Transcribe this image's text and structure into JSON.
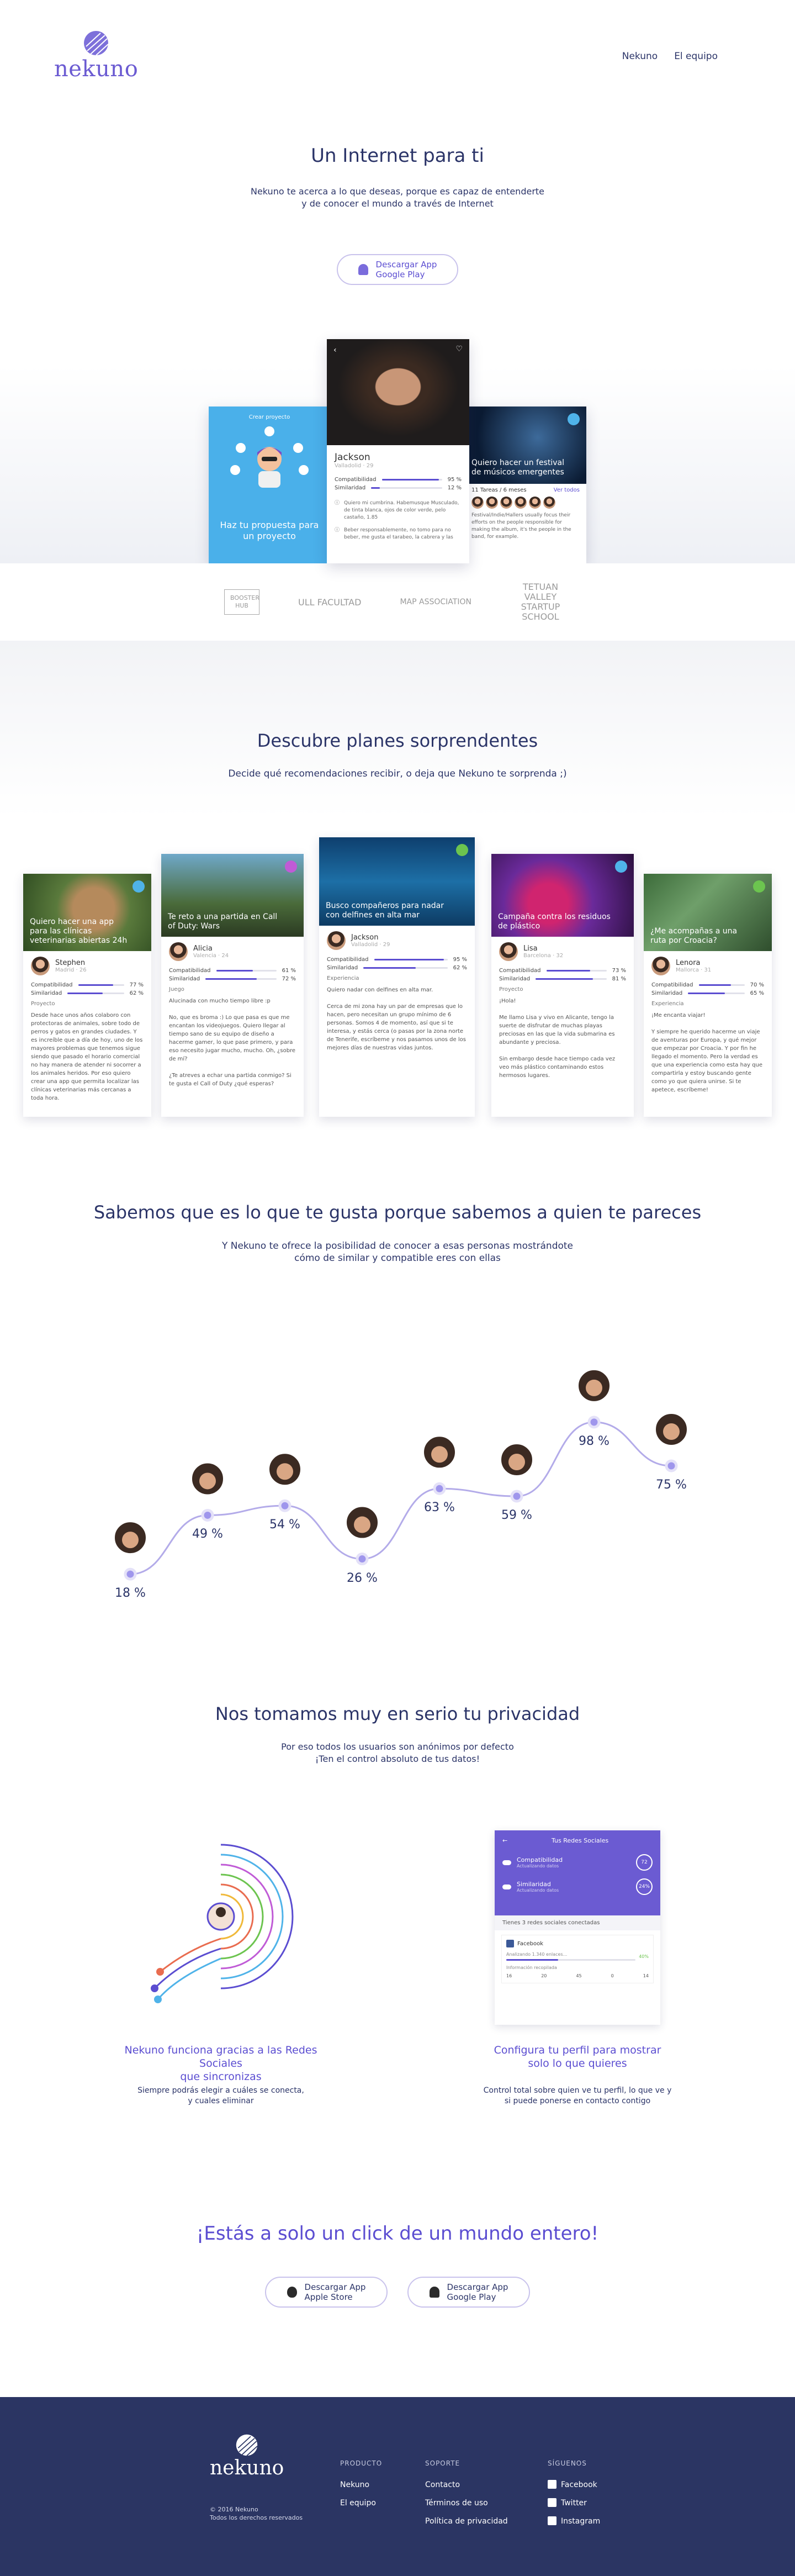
{
  "brand": {
    "name": "nekuno",
    "accent": "#5b4dd1",
    "dark": "#2b3468"
  },
  "nav": {
    "items": [
      "Nekuno",
      "El equipo"
    ]
  },
  "hero": {
    "title": "Un Internet para ti",
    "subtitle_l1": "Nekuno te acerca a lo que deseas, porque es capaz de entenderte",
    "subtitle_l2": "y de conocer el mundo a través de Internet",
    "download_l1": "Descargar App",
    "download_l2": "Google Play"
  },
  "hero_phones": {
    "left": {
      "top": "Crear proyecto",
      "caption": "Haz tu propuesta para un proyecto"
    },
    "center": {
      "name": "Jackson",
      "meta": "Valladolid · 29",
      "stat1": "Compatibilidad",
      "stat1_val": "95 %",
      "stat2": "Similaridad",
      "stat2_val": "12 %",
      "q1": "Quiero mi cumbrina. Habemusque Musculado, de tinta blanca, ojos de color verde, pelo castaño, 1.85",
      "q2": "Beber responsablemente, no tomo para no beber, me gusta el tarabeo, la cabrera y las"
    },
    "right": {
      "caption": "Quiero hacer un festival de músicos emergentes",
      "tab1": "11 Tareas / 6 meses",
      "tab2": "Ver todos",
      "text": "Festival/Indie/Hallers usually focus their efforts on the people responsible for making the album, it's the people in the band, for example."
    }
  },
  "partners": [
    "BOOSTER HUB",
    "ULL FACULTAD",
    "MAP ASSOCIATION",
    "TETUAN VALLEY STARTUP SCHOOL"
  ],
  "plans": {
    "title": "Descubre planes sorprendentes",
    "subtitle": "Decide qué recomendaciones recibir, o deja que Nekuno te sorprenda ;)",
    "cards": [
      {
        "caption": "Quiero hacer una app para las clínicas veterinarias abiertas 24h",
        "name": "Stephen",
        "meta": "Madrid · 26",
        "c": "77 %",
        "s": "62 %",
        "section": "Proyecto",
        "text": "Desde hace unos años colaboro con protectoras de animales, sobre todo de perros y gatos en grandes ciudades. Y es increíble que a día de hoy, uno de los mayores problemas que tenemos sigue siendo que pasado el horario comercial no hay manera de atender ni socorrer a los animales heridos. Por eso quiero crear una app que permita localizar las clínicas veterinarias más cercanas a toda hora.",
        "badge": "#4fb3e9"
      },
      {
        "caption": "Te reto a una partida en Call of Duty: Wars",
        "name": "Alicia",
        "meta": "Valencia · 24",
        "c": "61 %",
        "s": "72 %",
        "section": "Juego",
        "text": "Alucinada con mucho tiempo libre :p\n\nNo, que es broma :) Lo que pasa es que me encantan los videojuegos. Quiero llegar al tiempo sano de su equipo de diseño a hacerme gamer, lo que pase primero, y para eso necesito jugar mucho, mucho. Oh, ¿sobre de mí?\n\n¿Te atreves a echar una partida conmigo? Si te gusta el Call of Duty ¿qué esperas?",
        "badge": "#c05bd6"
      },
      {
        "caption": "Busco compañeros para nadar con delfines en alta mar",
        "name": "Jackson",
        "meta": "Valladolid · 29",
        "c": "95 %",
        "s": "62 %",
        "section": "Experiencia",
        "text": "Quiero nadar con delfines en alta mar.\n\nCerca de mi zona hay un par de empresas que lo hacen, pero necesitan un grupo mínimo de 6 personas. Somos 4 de momento, así que si te interesa, y estás cerca (o pasas por la zona norte de Tenerife, escríbeme y nos pasamos unos de los mejores días de nuestras vidas juntos.",
        "badge": "#6cc44f"
      },
      {
        "caption": "Campaña contra los residuos de plástico",
        "name": "Lisa",
        "meta": "Barcelona · 32",
        "c": "73 %",
        "s": "81 %",
        "section": "Proyecto",
        "text": "¡Hola!\n\nMe llamo Lisa y vivo en Alicante, tengo la suerte de disfrutar de muchas playas preciosas en las que la vida submarina es abundante y preciosa.\n\nSin embargo desde hace tiempo cada vez veo más plástico contaminando estos hermosos lugares.",
        "badge": "#4fb3e9"
      },
      {
        "caption": "¿Me acompañas a una ruta por Croacia?",
        "name": "Lenora",
        "meta": "Mallorca · 31",
        "c": "70 %",
        "s": "65 %",
        "section": "Experiencia",
        "text": "¡Me encanta viajar!\n\nY siempre he querido hacerme un viaje de aventuras por Europa, y qué mejor que empezar por Croacia. Y por fin he llegado el momento. Pero la verdad es que una experiencia como esta hay que compartirla y estoy buscando gente como yo que quiera unirse. Si te apetece, escríbeme!",
        "badge": "#6cc44f"
      }
    ]
  },
  "match": {
    "title": "Sabemos que es lo que te gusta porque sabemos a quien te pareces",
    "subtitle_l1": "Y Nekuno te ofrece la posibilidad de conocer a esas personas mostrándote",
    "subtitle_l2": "cómo de similar y compatible eres con ellas",
    "chart_data": {
      "type": "line",
      "categories": [
        "1",
        "2",
        "3",
        "4",
        "5",
        "6",
        "7",
        "8"
      ],
      "series": [
        {
          "values": [
            18,
            49,
            54,
            26,
            63,
            59,
            98,
            75
          ]
        }
      ],
      "labels": [
        "18 %",
        "49 %",
        "54 %",
        "26 %",
        "63 %",
        "59 %",
        "98 %",
        "75 %"
      ],
      "ylim": [
        0,
        100
      ]
    }
  },
  "privacy": {
    "title": "Nos tomamos muy en serio tu privacidad",
    "subtitle_l1": "Por eso todos los usuarios son anónimos por defecto",
    "subtitle_l2": "¡Ten el control absoluto de tus datos!",
    "left_title_l1": "Nekuno funciona gracias a las Redes Sociales",
    "left_title_l2": "que sincronizas",
    "left_text_l1": "Siempre podrás elegir a cuáles se conecta,",
    "left_text_l2": "y cuales eliminar",
    "right_title_l1": "Configura tu perfil para mostrar",
    "right_title_l2": "solo lo que quieres",
    "right_text_l1": "Control total sobre quien ve tu perfil, lo que ve y",
    "right_text_l2": "si puede ponerse en contacto contigo",
    "app": {
      "header": "Tus Redes Sociales",
      "row1": "Compatibilidad",
      "row1_sub": "Actualizando datos",
      "row1_val": "72",
      "row2": "Similaridad",
      "row2_sub": "Actualizando datos",
      "row2_val": "24%",
      "label": "Tienes 3 redes sociales conectadas",
      "fb": "Facebook",
      "fb_progress": "Analizando 1.340 enlaces...",
      "fb_pct": "40%",
      "info": "Información recopilada",
      "counts": [
        "16",
        "20",
        "45",
        "0",
        "14"
      ]
    }
  },
  "cta": {
    "title": "¡Estás a solo un click de un mundo entero!",
    "apple_l1": "Descargar App",
    "apple_l2": "Apple Store",
    "google_l1": "Descargar App",
    "google_l2": "Google Play"
  },
  "footer": {
    "copyright_l1": "© 2016 Nekuno",
    "copyright_l2": "Todos los derechos reservados",
    "producto": {
      "h": "PRODUCTO",
      "items": [
        "Nekuno",
        "El equipo"
      ]
    },
    "soporte": {
      "h": "SOPORTE",
      "items": [
        "Contacto",
        "Términos de uso",
        "Política de privacidad"
      ]
    },
    "siguenos": {
      "h": "SÍGUENOS",
      "items": [
        "Facebook",
        "Twitter",
        "Instagram"
      ]
    }
  }
}
